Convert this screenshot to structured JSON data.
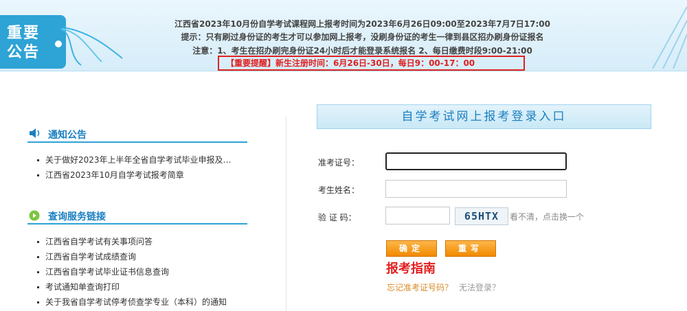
{
  "banner": {
    "tag_line1": "重要",
    "tag_line2": "公告",
    "line1": "江西省2023年10月份自学考试课程网上报考时间为2023年6月26日09:00至2023年7月7日17:00",
    "line2": "提示：只有刷过身份证的考生才可以参加网上报考，没刷身份证的考生一律到县区招办刷身份证报名",
    "line3": "注意：1、考生在招办刷完身份证24小时后才能登录系统报名   2、每日缴费时段9:00-21:00",
    "alert": "【重要提醒】新生注册时间：6月26日-30日，每日9：00-17：00"
  },
  "notice": {
    "title": "通知公告",
    "items": [
      "关于做好2023年上半年全省自学考试毕业申报及…",
      "江西省2023年10月自学考试报考简章"
    ]
  },
  "links": {
    "title": "查询服务链接",
    "items": [
      "江西省自学考试有关事项问答",
      "江西省自学考试成绩查询",
      "江西省自学考试毕业证书信息查询",
      "考试通知单查询打印",
      "关于我省自学考试停考侦查学专业（本科）的通知"
    ]
  },
  "login": {
    "title": "自学考试网上报考登录入口",
    "id_label": "准考证号：",
    "name_label": "考生姓名：",
    "captcha_label": "验 证 码：",
    "captcha_text": "65HTX",
    "refresh_text": "看不清，点击换一个",
    "confirm_label": "确定",
    "reset_label": "重写",
    "guide": "报考指南",
    "forgot": "忘记准考证号码？",
    "cannot_login": "无法登录？"
  },
  "colors": {
    "accent": "#2ea3d6",
    "alert": "#e02020",
    "button": "#f08a00"
  }
}
